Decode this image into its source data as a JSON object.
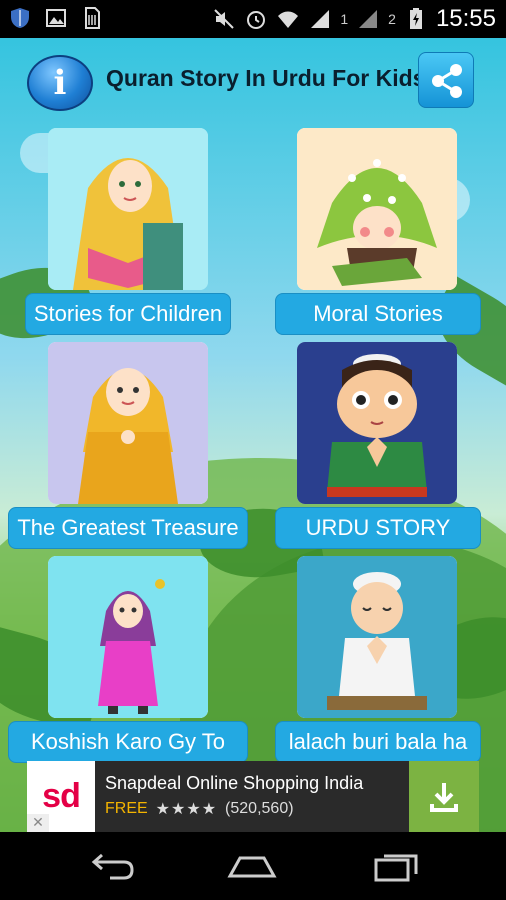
{
  "status_bar": {
    "time": "15:55",
    "sim1": "1",
    "sim2": "2",
    "icons": [
      "shield-icon",
      "image-icon",
      "sim-card-icon",
      "mute-icon",
      "alarm-icon",
      "wifi-icon",
      "signal-icon",
      "battery-charging-icon"
    ]
  },
  "header": {
    "title": "Quran Story In Urdu For Kids",
    "info_glyph": "i",
    "info_icon": "info-icon",
    "share_icon": "share-icon"
  },
  "tiles": [
    {
      "label": "Stories for Children"
    },
    {
      "label": "Moral Stories"
    },
    {
      "label": "The Greatest Treasure"
    },
    {
      "label": "URDU STORY"
    },
    {
      "label": "Koshish Karo Gy To"
    },
    {
      "label": "lalach buri bala ha"
    }
  ],
  "ad": {
    "logo_text": "sd",
    "title": "Snapdeal Online Shopping India",
    "price": "FREE",
    "stars": "★★★★",
    "rating_count": "(520,560)",
    "download_icon": "download-icon",
    "close_glyph": "✕"
  },
  "nav": {
    "buttons": [
      "back-icon",
      "home-icon",
      "recent-apps-icon"
    ]
  },
  "colors": {
    "label_bg": "#23a9e2",
    "status_bg": "#000000",
    "ad_download_bg": "#7cb342",
    "ad_free": "#f4b400"
  }
}
